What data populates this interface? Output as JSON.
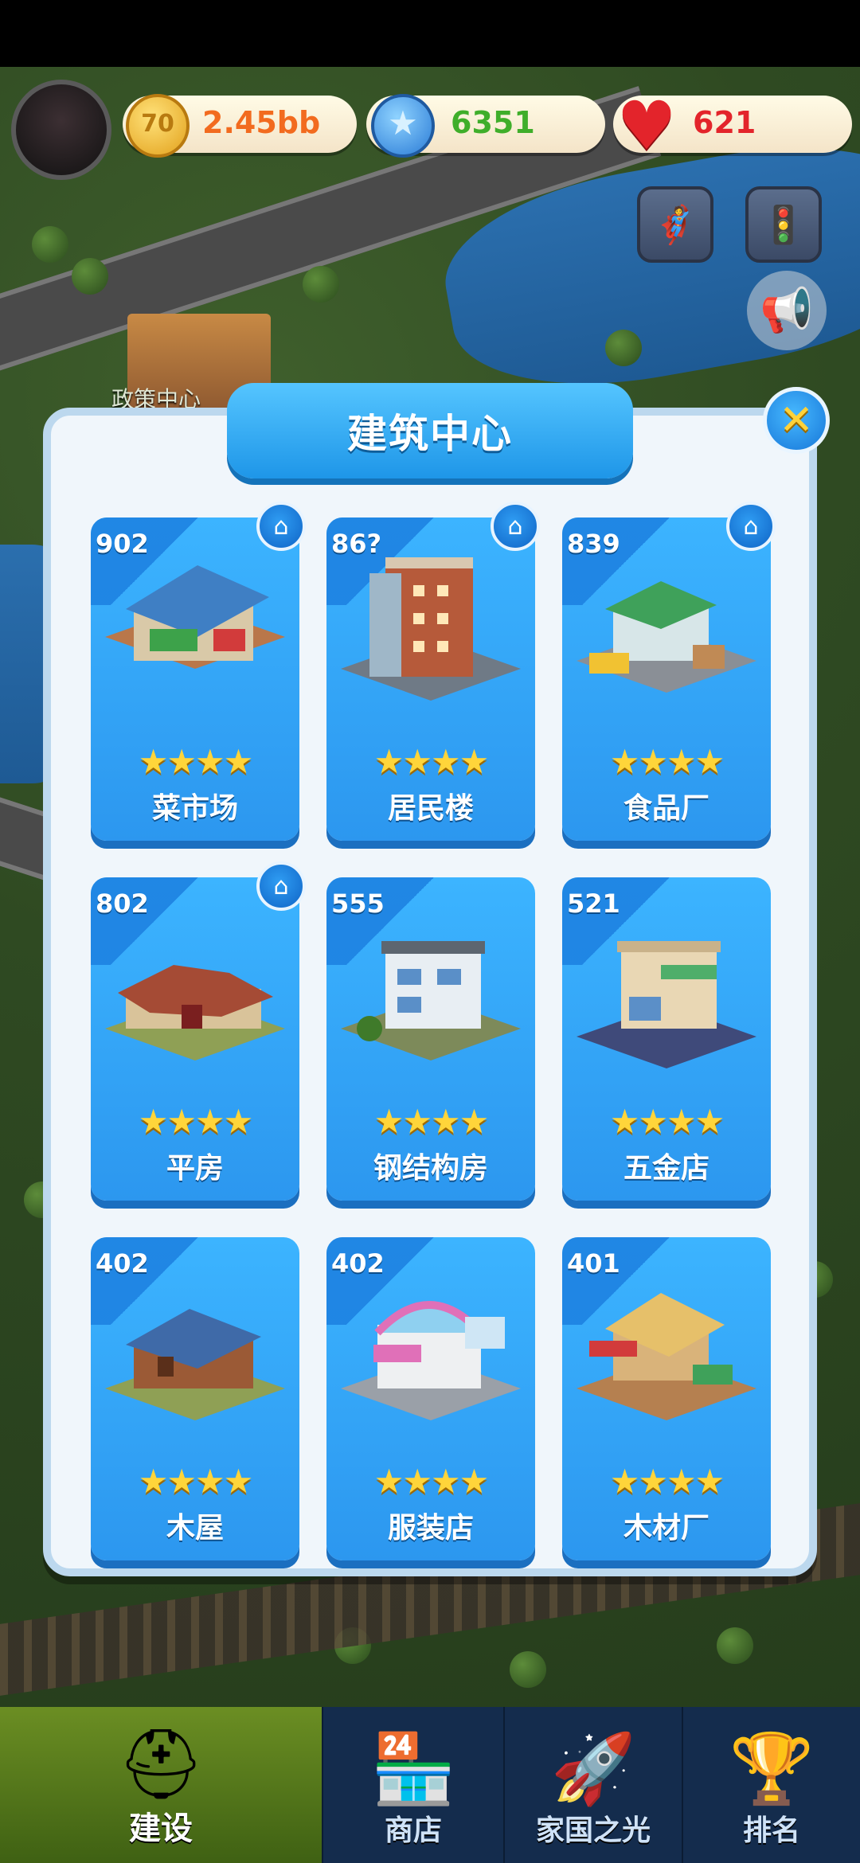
{
  "hud": {
    "coins": "2.45bb",
    "gems": "6351",
    "hearts": "621"
  },
  "map": {
    "label": "政策中心"
  },
  "modal": {
    "title": "建筑中心"
  },
  "buildings": [
    {
      "level": "902",
      "name": "菜市场",
      "stars": "★★★★",
      "home": true
    },
    {
      "level": "86?",
      "name": "居民楼",
      "stars": "★★★★",
      "home": true
    },
    {
      "level": "839",
      "name": "食品厂",
      "stars": "★★★★",
      "home": true
    },
    {
      "level": "802",
      "name": "平房",
      "stars": "★★★★",
      "home": true
    },
    {
      "level": "555",
      "name": "钢结构房",
      "stars": "★★★★",
      "home": false
    },
    {
      "level": "521",
      "name": "五金店",
      "stars": "★★★★",
      "home": false
    },
    {
      "level": "402",
      "name": "木屋",
      "stars": "★★★★",
      "home": false
    },
    {
      "level": "402",
      "name": "服装店",
      "stars": "★★★★",
      "home": false
    },
    {
      "level": "401",
      "name": "木材厂",
      "stars": "★★★★",
      "home": false
    }
  ],
  "nav": {
    "tabs": [
      {
        "label": "建设"
      },
      {
        "label": "商店"
      },
      {
        "label": "家国之光"
      },
      {
        "label": "排名"
      }
    ]
  },
  "colors": {
    "card_blue": "#2c97ef",
    "star_yellow": "#ffd53a",
    "coin_text": "#f26b1f",
    "gem_text": "#3fae2a",
    "heart_text": "#e3242b"
  }
}
